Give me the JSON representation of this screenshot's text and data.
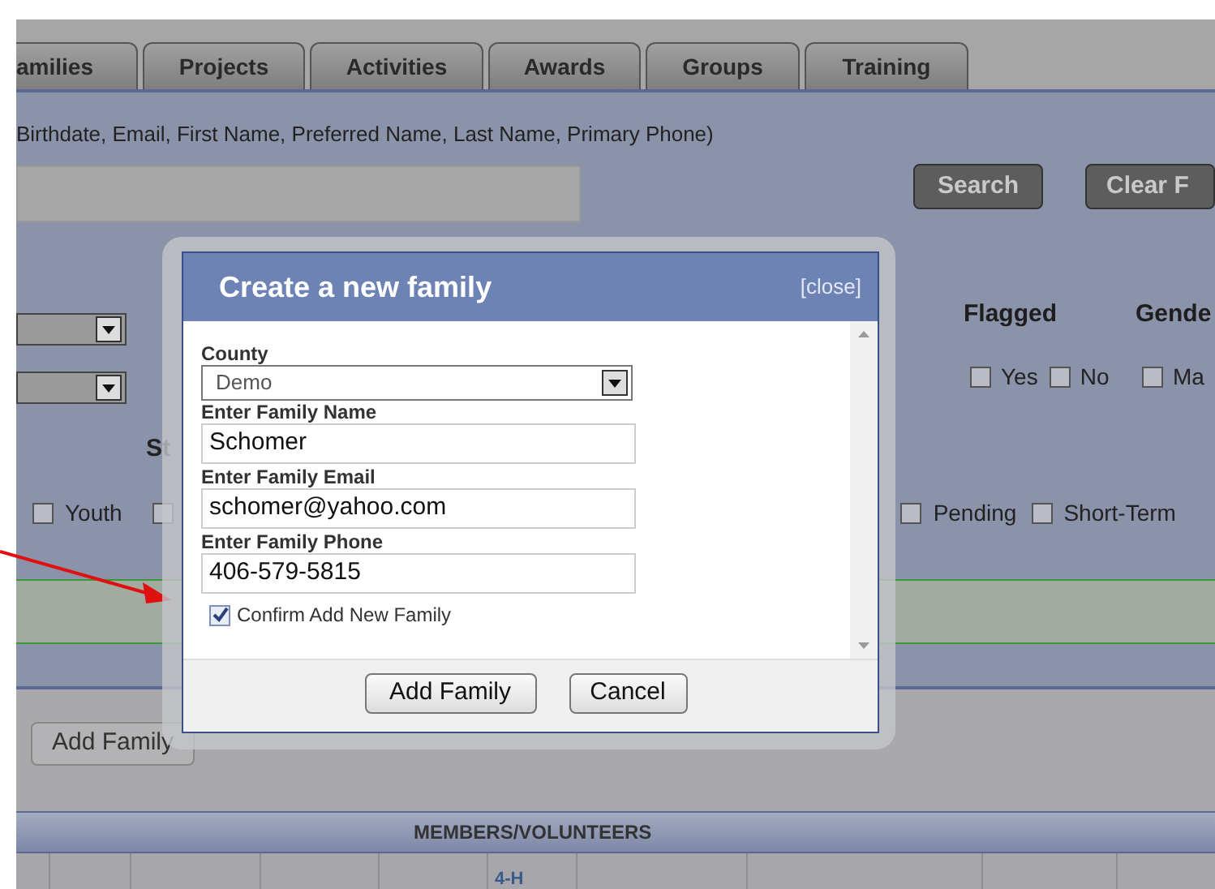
{
  "tabs": [
    {
      "label": "amilies",
      "selected": false
    },
    {
      "label": "Projects",
      "selected": false
    },
    {
      "label": "Activities",
      "selected": false
    },
    {
      "label": "Awards",
      "selected": false
    },
    {
      "label": "Groups",
      "selected": false
    },
    {
      "label": "Training",
      "selected": false
    }
  ],
  "search": {
    "hint": "Birthdate, Email, First Name, Preferred Name, Last Name, Primary Phone)",
    "buttons": [
      "Search",
      "Clear F"
    ]
  },
  "filter_groups": [
    {
      "title": "Flagged",
      "options": [
        {
          "label": "Yes",
          "checked": false
        },
        {
          "label": "No",
          "checked": false
        }
      ]
    },
    {
      "title": "Gende",
      "options": [
        {
          "label": "Ma",
          "checked": false
        }
      ]
    }
  ],
  "status": {
    "title": "St",
    "options": [
      {
        "label": "Youth",
        "checked": false
      },
      {
        "checked": false
      },
      {
        "label": "Pending",
        "checked": false
      },
      {
        "label": "Short-Term",
        "checked": false
      }
    ]
  },
  "add_button": "Add Family",
  "table": {
    "header": "MEMBERS/VOLUNTEERS",
    "row_text": "4-H"
  },
  "dialog": {
    "title": "Create a new family",
    "close": "[close]",
    "fields": [
      {
        "kind": "select",
        "label": "County",
        "value": "Demo"
      },
      {
        "kind": "text",
        "label": "Enter Family Name",
        "value": "Schomer"
      },
      {
        "kind": "text",
        "label": "Enter Family Email",
        "value": "schomer@yahoo.com"
      },
      {
        "kind": "text",
        "label": "Enter Family Phone",
        "value": "406-579-5815"
      }
    ],
    "confirm": {
      "label": "Confirm Add New Family",
      "checked": true
    },
    "buttons": [
      "Add Family",
      "Cancel"
    ]
  }
}
